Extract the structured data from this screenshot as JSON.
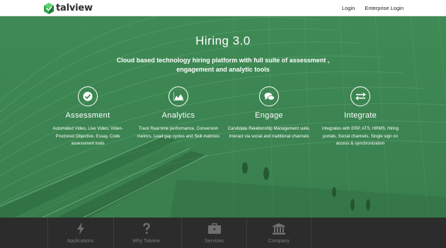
{
  "brand": {
    "name": "talview",
    "color": "#2ea84a"
  },
  "nav": {
    "login": "Login",
    "enterprise_login": "Enterprise Login"
  },
  "hero": {
    "title": "Hiring 3.0",
    "subtitle": "Cloud based technology hiring platform with full suite of assessment , engagement and analytic tools",
    "overlay_color": "#3d8753"
  },
  "features": [
    {
      "icon": "check-icon",
      "title": "Assessment",
      "desc": "Automated Video, Live Video, Video-Proctored Objective, Essay, Code assessment tools"
    },
    {
      "icon": "area-chart-icon",
      "title": "Analytics",
      "desc": "Track Real time performance, Conversion metrics, Lead gap cycles and Skill matrices"
    },
    {
      "icon": "chat-bubbles-icon",
      "title": "Engage",
      "desc": "Candidate Relationship Management suite, Interact via social and traditional channels"
    },
    {
      "icon": "exchange-arrows-icon",
      "title": "Integrate",
      "desc": "Integrates with ERP, ATS, HRMS, Hiring portals, Social channels, Single sign on access & synchronization"
    }
  ],
  "bottom_nav": [
    {
      "icon": "bolt-icon",
      "label": "Applications"
    },
    {
      "icon": "question-icon",
      "label": "Why Talview"
    },
    {
      "icon": "briefcase-icon",
      "label": "Services"
    },
    {
      "icon": "institution-icon",
      "label": "Company"
    }
  ]
}
